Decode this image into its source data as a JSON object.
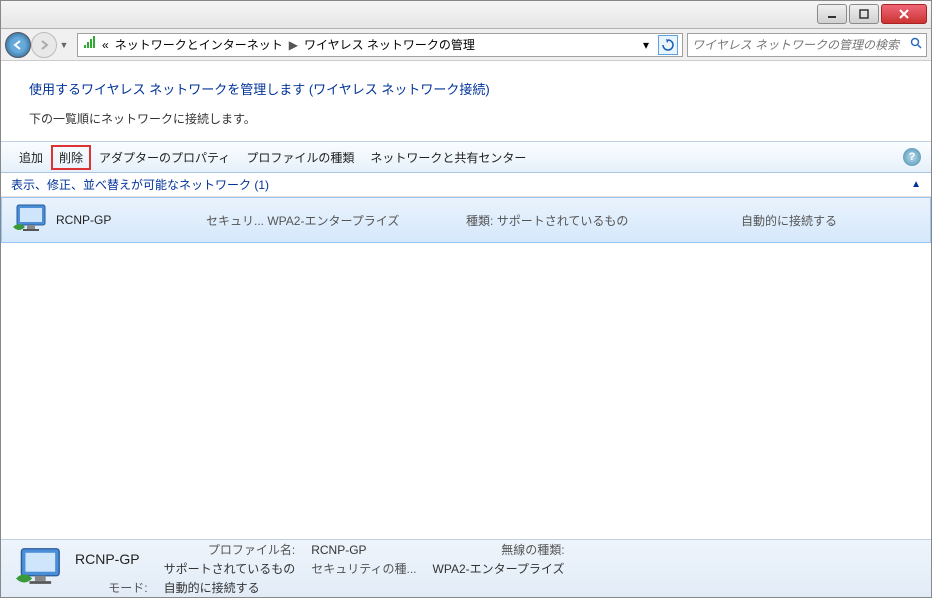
{
  "titlebar": {},
  "nav": {
    "crumb_sep": "«",
    "crumb1": "ネットワークとインターネット",
    "crumb2": "ワイヤレス ネットワークの管理",
    "search_placeholder": "ワイヤレス ネットワークの管理の検索"
  },
  "header": {
    "heading": "使用するワイヤレス ネットワークを管理します (ワイヤレス ネットワーク接続)",
    "subtext": "下の一覧順にネットワークに接続します。"
  },
  "toolbar": {
    "add": "追加",
    "remove": "削除",
    "adapter_props": "アダプターのプロパティ",
    "profile_types": "プロファイルの種類",
    "sharing_center": "ネットワークと共有センター"
  },
  "group": {
    "label": "表示、修正、並べ替えが可能なネットワーク (1)"
  },
  "rows": [
    {
      "name": "RCNP-GP",
      "security_label": "セキュリ...",
      "security_value": "WPA2-エンタープライズ",
      "type_label": "種類:",
      "type_value": "サポートされているもの",
      "connect": "自動的に接続する"
    }
  ],
  "details": {
    "name": "RCNP-GP",
    "profile_label": "プロファイル名:",
    "profile_value": "RCNP-GP",
    "wireless_type_label": "無線の種類:",
    "wireless_type_value": "サポートされているもの",
    "security_label": "セキュリティの種...",
    "security_value": "WPA2-エンタープライズ",
    "mode_label": "モード:",
    "mode_value": "自動的に接続する"
  }
}
